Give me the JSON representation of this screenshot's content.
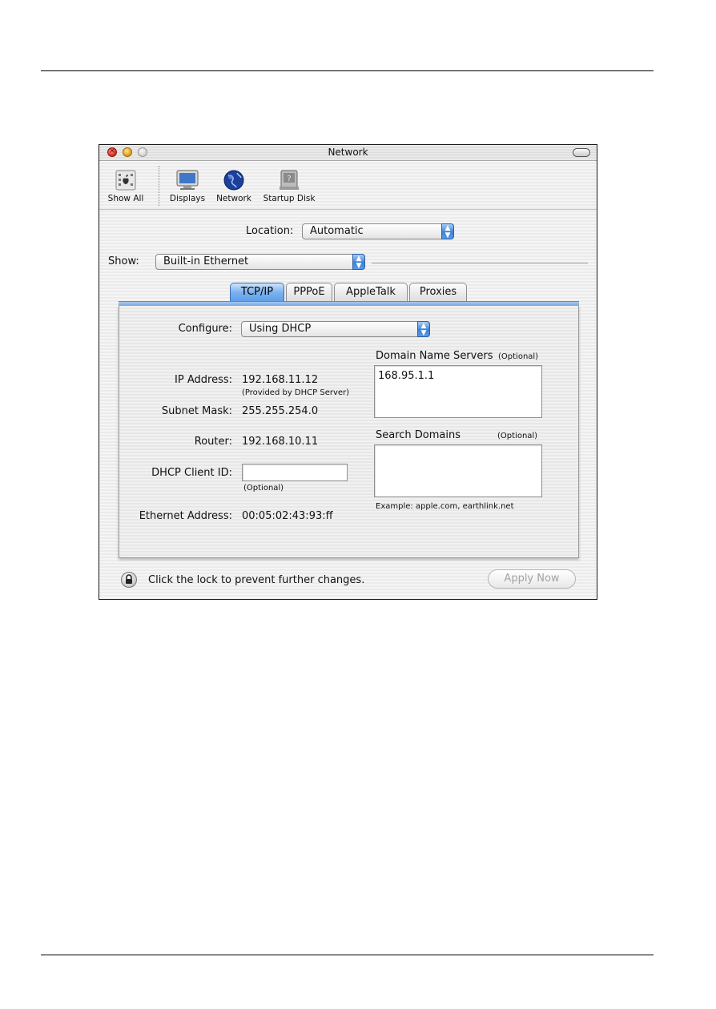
{
  "window": {
    "title": "Network"
  },
  "toolbar": {
    "items": [
      {
        "label": "Show All",
        "icon": "apple-grid-icon"
      },
      {
        "label": "Displays",
        "icon": "display-icon"
      },
      {
        "label": "Network",
        "icon": "globe-icon"
      },
      {
        "label": "Startup Disk",
        "icon": "disk-icon"
      }
    ]
  },
  "location": {
    "label": "Location:",
    "value": "Automatic"
  },
  "show": {
    "label": "Show:",
    "value": "Built-in Ethernet"
  },
  "tabs": [
    {
      "label": "TCP/IP",
      "active": true
    },
    {
      "label": "PPPoE",
      "active": false
    },
    {
      "label": "AppleTalk",
      "active": false
    },
    {
      "label": "Proxies",
      "active": false
    }
  ],
  "tcpip": {
    "configure_label": "Configure:",
    "configure_value": "Using DHCP",
    "ip_label": "IP Address:",
    "ip_value": "192.168.11.12",
    "ip_note": "(Provided by DHCP Server)",
    "subnet_label": "Subnet Mask:",
    "subnet_value": "255.255.254.0",
    "router_label": "Router:",
    "router_value": "192.168.10.11",
    "dhcp_client_label": "DHCP Client ID:",
    "dhcp_client_value": "",
    "dhcp_client_note": "(Optional)",
    "ethernet_label": "Ethernet Address:",
    "ethernet_value": "00:05:02:43:93:ff",
    "dns_label": "Domain Name Servers",
    "dns_optional": "(Optional)",
    "dns_value": "168.95.1.1",
    "search_label": "Search Domains",
    "search_optional": "(Optional)",
    "search_value": "",
    "example": "Example: apple.com, earthlink.net"
  },
  "footer": {
    "lock_text": "Click the lock to prevent further changes.",
    "apply_label": "Apply Now"
  }
}
